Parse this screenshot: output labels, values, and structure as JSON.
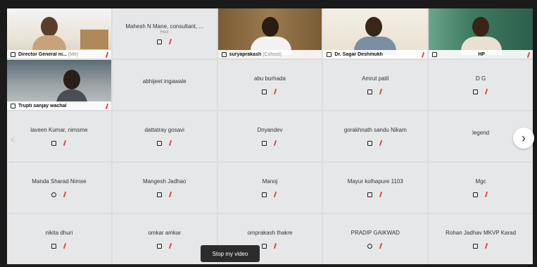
{
  "participants": [
    {
      "name": "Director General ni...",
      "tag": "(Me)",
      "video": true
    },
    {
      "name": "Mahesh N Mane, consultant, ...",
      "sub": "Host",
      "video": false
    },
    {
      "name": "suryaprakash",
      "tag": "(Cohost)",
      "video": true,
      "active": true
    },
    {
      "name": "Dr. Sagar Deshmukh",
      "video": true
    },
    {
      "name": "HP",
      "video": true
    },
    {
      "name": "Trupti sanjay wachal",
      "video": true
    },
    {
      "name": "abhijeet ingawale",
      "video": false
    },
    {
      "name": "abu burhada",
      "video": false
    },
    {
      "name": "Amrut patil",
      "video": false
    },
    {
      "name": "D G",
      "video": false
    },
    {
      "name": "laveen Kumar, nimsme",
      "video": false
    },
    {
      "name": "dattatray gosavi",
      "video": false
    },
    {
      "name": "Dnyandev",
      "video": false
    },
    {
      "name": "gorakhnath sandu Nikam",
      "video": false
    },
    {
      "name": "legend",
      "video": false
    },
    {
      "name": "Manda Sharad Nimse",
      "video": false
    },
    {
      "name": "Mangesh Jadhao",
      "video": false
    },
    {
      "name": "Manoj",
      "video": false
    },
    {
      "name": "Mayur kolhapure 1103",
      "video": false
    },
    {
      "name": "Mgc",
      "video": false
    },
    {
      "name": "nikita dhuri",
      "video": false
    },
    {
      "name": "omkar amkar",
      "video": false
    },
    {
      "name": "omprakash thakre",
      "video": false
    },
    {
      "name": "PRADIP GAIKWAD",
      "video": false
    },
    {
      "name": "Rohan Jadhav MKVP Karad",
      "video": false
    }
  ],
  "controls": {
    "stop_video_label": "Stop my video",
    "next_page_glyph": "›",
    "prev_page_glyph": "‹"
  }
}
